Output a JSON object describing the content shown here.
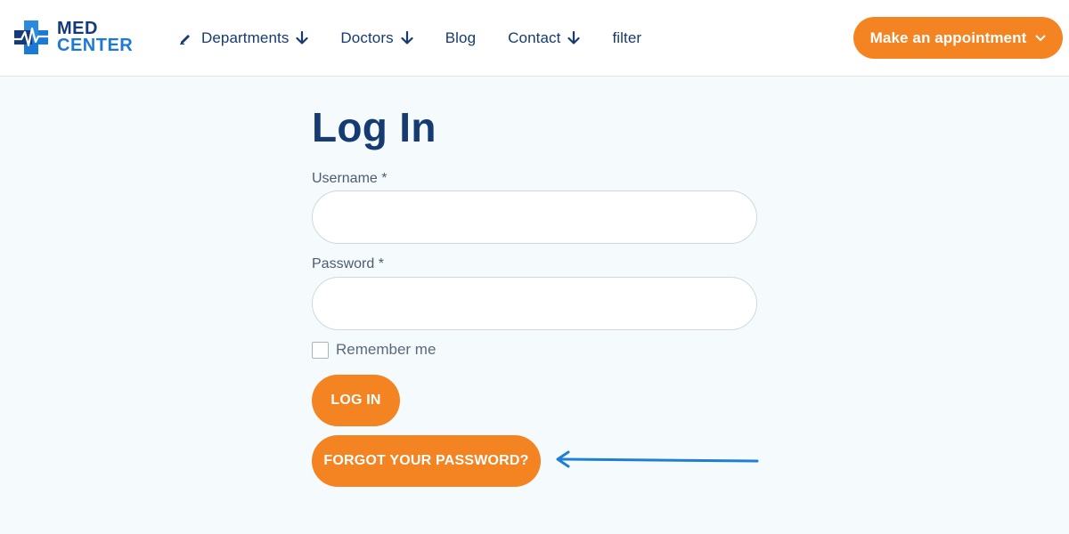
{
  "header": {
    "logo": {
      "line1": "MED",
      "line2": "CENTER",
      "icon": "medical-cross-heartbeat-icon"
    },
    "nav": [
      {
        "label": "Departments",
        "pre_icon": "pencil-icon",
        "has_dropdown": true
      },
      {
        "label": "Doctors",
        "has_dropdown": true
      },
      {
        "label": "Blog",
        "has_dropdown": false
      },
      {
        "label": "Contact",
        "has_dropdown": true
      },
      {
        "label": "filter",
        "has_dropdown": false
      }
    ],
    "cta": {
      "label": "Make an appointment",
      "icon": "chevron-down-icon"
    }
  },
  "login": {
    "title": "Log In",
    "username": {
      "label": "Username *",
      "value": "",
      "placeholder": ""
    },
    "password": {
      "label": "Password *",
      "value": "",
      "placeholder": ""
    },
    "remember": {
      "label": "Remember me",
      "checked": false
    },
    "login_button": "LOG IN",
    "forgot_button": "FORGOT YOUR PASSWORD?"
  },
  "annotation": {
    "icon": "arrow-left-icon",
    "color": "#1e7fd4"
  },
  "colors": {
    "brand_navy": "#163a72",
    "brand_blue": "#1c7ad6",
    "accent_orange": "#f48322",
    "page_bg": "#f5fafd"
  }
}
